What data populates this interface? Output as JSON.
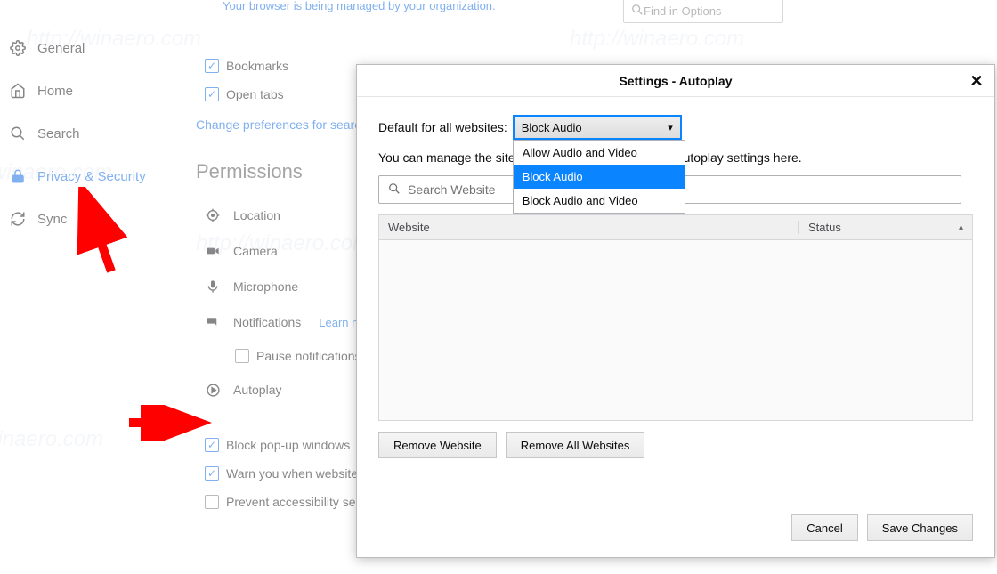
{
  "topbar": {
    "managed_msg": "Your browser is being managed by your organization.",
    "find_placeholder": "Find in Options"
  },
  "sidebar": {
    "items": [
      {
        "label": "General",
        "icon": "gear"
      },
      {
        "label": "Home",
        "icon": "home"
      },
      {
        "label": "Search",
        "icon": "search"
      },
      {
        "label": "Privacy & Security",
        "icon": "lock",
        "selected": true
      },
      {
        "label": "Sync",
        "icon": "sync"
      }
    ]
  },
  "main": {
    "bookmarks_label": "Bookmarks",
    "open_tabs_label": "Open tabs",
    "change_prefs_link": "Change preferences for search engine suggestions…",
    "permissions_heading": "Permissions",
    "location_label": "Location",
    "camera_label": "Camera",
    "microphone_label": "Microphone",
    "notifications_label": "Notifications",
    "learn_more": "Learn more",
    "pause_notifications_label": "Pause notifications until Firefox restarts",
    "autoplay_label": "Autoplay",
    "block_popup_label": "Block pop-up windows",
    "warn_addons_label": "Warn you when websites try to install add-ons",
    "prevent_accessibility_label": "Prevent accessibility services from accessing your browser"
  },
  "modal": {
    "title": "Settings - Autoplay",
    "default_label": "Default for all websites:",
    "manage_text_before": "You can manage the sites",
    "manage_text_after": "utoplay settings here.",
    "selected_option": "Block Audio",
    "options": [
      "Allow Audio and Video",
      "Block Audio",
      "Block Audio and Video"
    ],
    "search_placeholder": "Search Website",
    "th_website": "Website",
    "th_status": "Status",
    "remove_website": "Remove Website",
    "remove_all": "Remove All Websites",
    "cancel": "Cancel",
    "save": "Save Changes"
  },
  "watermark": "http://winaero.com"
}
